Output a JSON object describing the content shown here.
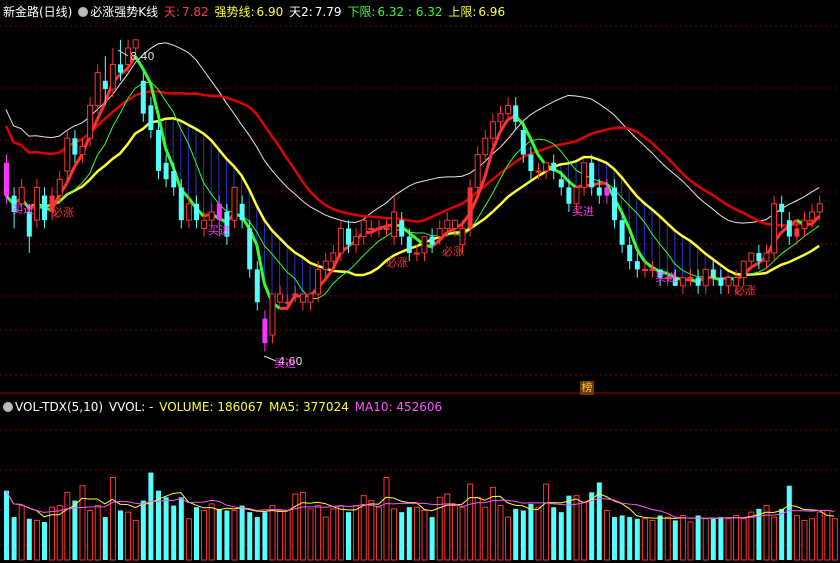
{
  "header": {
    "title": "新金路(日线)",
    "indicator": "必涨强势K线",
    "tian_label": "天:",
    "tian_value": "7.82",
    "strong_label": "强势线:",
    "strong_value": "6.90",
    "tian2_label": "天2:",
    "tian2_value": "7.79",
    "lower_label": "下限:",
    "lower_value": "6.32 : 6.32",
    "upper_label": "上限:",
    "upper_value": "6.96"
  },
  "vol_header": {
    "name": "VOL-TDX(5,10)",
    "vvol": "VVOL: -",
    "volume": "VOLUME: 186067",
    "ma5": "MA5: 377024",
    "ma10": "MA10: 452606"
  },
  "annotations": {
    "high": "8.40",
    "low": "4.60",
    "buy": "买进",
    "up": "必涨",
    "bang": "榜"
  },
  "colors": {
    "up": "#ff3333",
    "down": "#54ffff",
    "magenta": "#ff33ff",
    "yellow": "#ffff33",
    "red_line": "#e00000",
    "white_line": "#e8e8e8",
    "green_line": "#33ff33",
    "blue_fill": "#2233cc",
    "grid": "#7a0000"
  },
  "chart_data": {
    "type": "candlestick",
    "candles": [
      [
        6.9,
        6.5,
        7.0,
        6.4
      ],
      [
        6.5,
        6.3,
        6.6,
        6.1
      ],
      [
        6.4,
        6.6,
        6.7,
        6.3
      ],
      [
        6.3,
        6.0,
        6.4,
        5.8
      ],
      [
        6.2,
        6.6,
        6.7,
        6.1
      ],
      [
        6.5,
        6.2,
        6.6,
        6.1
      ],
      [
        6.3,
        6.5,
        6.6,
        6.2
      ],
      [
        6.5,
        6.7,
        6.8,
        6.4
      ],
      [
        6.8,
        7.2,
        7.3,
        6.7
      ],
      [
        7.2,
        7.0,
        7.3,
        6.9
      ],
      [
        7.0,
        7.1,
        7.2,
        6.9
      ],
      [
        7.2,
        7.6,
        7.7,
        7.1
      ],
      [
        7.6,
        8.0,
        8.1,
        7.5
      ],
      [
        7.9,
        7.8,
        8.2,
        7.6
      ],
      [
        7.8,
        8.1,
        8.3,
        7.7
      ],
      [
        8.1,
        8.0,
        8.4,
        7.9
      ],
      [
        8.1,
        8.3,
        8.4,
        8.0
      ],
      [
        8.3,
        8.4,
        8.4,
        8.2
      ],
      [
        7.9,
        7.5,
        8.0,
        7.4
      ],
      [
        7.6,
        7.3,
        7.7,
        7.2
      ],
      [
        7.3,
        6.8,
        7.4,
        6.7
      ],
      [
        6.9,
        6.7,
        7.0,
        6.6
      ],
      [
        6.8,
        6.6,
        6.9,
        6.5
      ],
      [
        6.6,
        6.2,
        6.7,
        6.1
      ],
      [
        6.2,
        6.4,
        6.5,
        6.1
      ],
      [
        6.4,
        6.2,
        6.5,
        6.1
      ],
      [
        6.1,
        6.2,
        6.3,
        6.0
      ],
      [
        6.2,
        6.3,
        6.4,
        6.1
      ],
      [
        6.4,
        6.2,
        6.5,
        6.0
      ],
      [
        6.3,
        6.0,
        6.4,
        5.9
      ],
      [
        6.2,
        6.6,
        6.6,
        6.1
      ],
      [
        6.4,
        6.2,
        6.5,
        6.1
      ],
      [
        6.1,
        5.6,
        6.2,
        5.5
      ],
      [
        5.6,
        5.2,
        5.7,
        5.1
      ],
      [
        5.0,
        4.7,
        5.1,
        4.6
      ],
      [
        4.8,
        5.3,
        5.3,
        4.7
      ],
      [
        5.2,
        5.3,
        5.4,
        5.2
      ],
      [
        5.2,
        5.2,
        5.3,
        5.1
      ],
      [
        5.3,
        5.3,
        5.4,
        5.2
      ],
      [
        5.2,
        5.3,
        5.3,
        5.1
      ],
      [
        5.2,
        5.3,
        5.3,
        5.1
      ],
      [
        5.3,
        5.6,
        5.7,
        5.2
      ],
      [
        5.6,
        5.7,
        5.8,
        5.5
      ],
      [
        5.7,
        5.8,
        5.9,
        5.6
      ],
      [
        5.8,
        6.1,
        6.2,
        5.7
      ],
      [
        6.1,
        5.9,
        6.2,
        5.8
      ],
      [
        5.9,
        6.0,
        6.1,
        5.8
      ],
      [
        6.0,
        6.2,
        6.2,
        5.9
      ],
      [
        6.1,
        6.1,
        6.2,
        6.0
      ],
      [
        6.1,
        6.1,
        6.2,
        6.0
      ],
      [
        6.1,
        6.1,
        6.2,
        6.0
      ],
      [
        6.0,
        6.3,
        6.5,
        5.9
      ],
      [
        6.2,
        6.0,
        6.3,
        5.9
      ],
      [
        6.0,
        5.8,
        6.1,
        5.7
      ],
      [
        5.8,
        5.8,
        5.9,
        5.7
      ],
      [
        5.8,
        6.0,
        6.0,
        5.7
      ],
      [
        6.0,
        5.9,
        6.1,
        5.8
      ],
      [
        6.0,
        6.1,
        6.2,
        5.9
      ],
      [
        6.1,
        6.2,
        6.3,
        6.0
      ],
      [
        6.1,
        6.2,
        6.2,
        6.0
      ],
      [
        5.9,
        6.1,
        6.2,
        5.8
      ],
      [
        6.1,
        6.6,
        6.7,
        6.0
      ],
      [
        6.6,
        7.0,
        7.1,
        6.5
      ],
      [
        7.0,
        7.2,
        7.3,
        6.9
      ],
      [
        7.2,
        7.4,
        7.5,
        7.1
      ],
      [
        7.4,
        7.5,
        7.6,
        7.3
      ],
      [
        7.5,
        7.6,
        7.7,
        7.4
      ],
      [
        7.6,
        7.4,
        7.7,
        7.3
      ],
      [
        7.3,
        7.0,
        7.4,
        6.9
      ],
      [
        7.0,
        6.8,
        7.1,
        6.7
      ],
      [
        6.8,
        6.8,
        6.9,
        6.7
      ],
      [
        6.8,
        6.9,
        6.9,
        6.7
      ],
      [
        6.9,
        6.8,
        7.0,
        6.7
      ],
      [
        6.7,
        6.6,
        6.8,
        6.5
      ],
      [
        6.6,
        6.4,
        6.7,
        6.3
      ],
      [
        6.4,
        6.6,
        6.6,
        6.3
      ],
      [
        6.6,
        6.9,
        6.9,
        6.5
      ],
      [
        6.9,
        6.6,
        7.0,
        6.5
      ],
      [
        6.6,
        6.5,
        6.7,
        6.4
      ],
      [
        6.5,
        6.6,
        6.7,
        6.4
      ],
      [
        6.6,
        6.2,
        6.7,
        6.1
      ],
      [
        6.2,
        5.9,
        6.3,
        5.8
      ],
      [
        5.9,
        5.7,
        6.0,
        5.6
      ],
      [
        5.7,
        5.6,
        5.8,
        5.5
      ],
      [
        5.6,
        5.6,
        5.7,
        5.5
      ],
      [
        5.6,
        5.6,
        5.7,
        5.5
      ],
      [
        5.6,
        5.5,
        5.6,
        5.4
      ],
      [
        5.5,
        5.5,
        5.6,
        5.4
      ],
      [
        5.5,
        5.4,
        5.6,
        5.4
      ],
      [
        5.4,
        5.5,
        5.5,
        5.3
      ],
      [
        5.5,
        5.5,
        5.6,
        5.4
      ],
      [
        5.5,
        5.4,
        5.6,
        5.3
      ],
      [
        5.4,
        5.6,
        5.6,
        5.3
      ],
      [
        5.6,
        5.5,
        5.7,
        5.4
      ],
      [
        5.5,
        5.4,
        5.6,
        5.3
      ],
      [
        5.4,
        5.5,
        5.5,
        5.3
      ],
      [
        5.4,
        5.5,
        5.6,
        5.3
      ],
      [
        5.5,
        5.7,
        5.7,
        5.4
      ],
      [
        5.7,
        5.8,
        5.8,
        5.6
      ],
      [
        5.8,
        5.7,
        5.9,
        5.6
      ],
      [
        5.7,
        5.8,
        5.9,
        5.6
      ],
      [
        5.8,
        6.4,
        6.5,
        5.7
      ],
      [
        6.4,
        6.3,
        6.5,
        6.1
      ],
      [
        6.2,
        6.0,
        6.3,
        5.9
      ],
      [
        6.0,
        6.1,
        6.2,
        5.9
      ],
      [
        6.1,
        6.2,
        6.3,
        6.0
      ],
      [
        6.2,
        6.3,
        6.4,
        6.1
      ],
      [
        6.3,
        6.4,
        6.5,
        6.2
      ]
    ],
    "volume": [
      420,
      260,
      330,
      250,
      240,
      230,
      320,
      330,
      410,
      360,
      450,
      300,
      330,
      260,
      500,
      300,
      290,
      240,
      360,
      530,
      420,
      380,
      330,
      380,
      250,
      320,
      300,
      340,
      310,
      300,
      300,
      330,
      290,
      260,
      290,
      330,
      300,
      300,
      400,
      410,
      310,
      330,
      260,
      310,
      330,
      290,
      330,
      390,
      360,
      320,
      500,
      310,
      290,
      320,
      320,
      300,
      260,
      380,
      400,
      330,
      320,
      460,
      380,
      320,
      440,
      330,
      260,
      310,
      300,
      340,
      320,
      460,
      320,
      290,
      390,
      390,
      350,
      410,
      470,
      300,
      260,
      270,
      260,
      250,
      250,
      240,
      270,
      260,
      240,
      270,
      230,
      270,
      250,
      250,
      260,
      250,
      270,
      250,
      290,
      310,
      330,
      260,
      310,
      450,
      270,
      240,
      250,
      290,
      300,
      250
    ]
  }
}
